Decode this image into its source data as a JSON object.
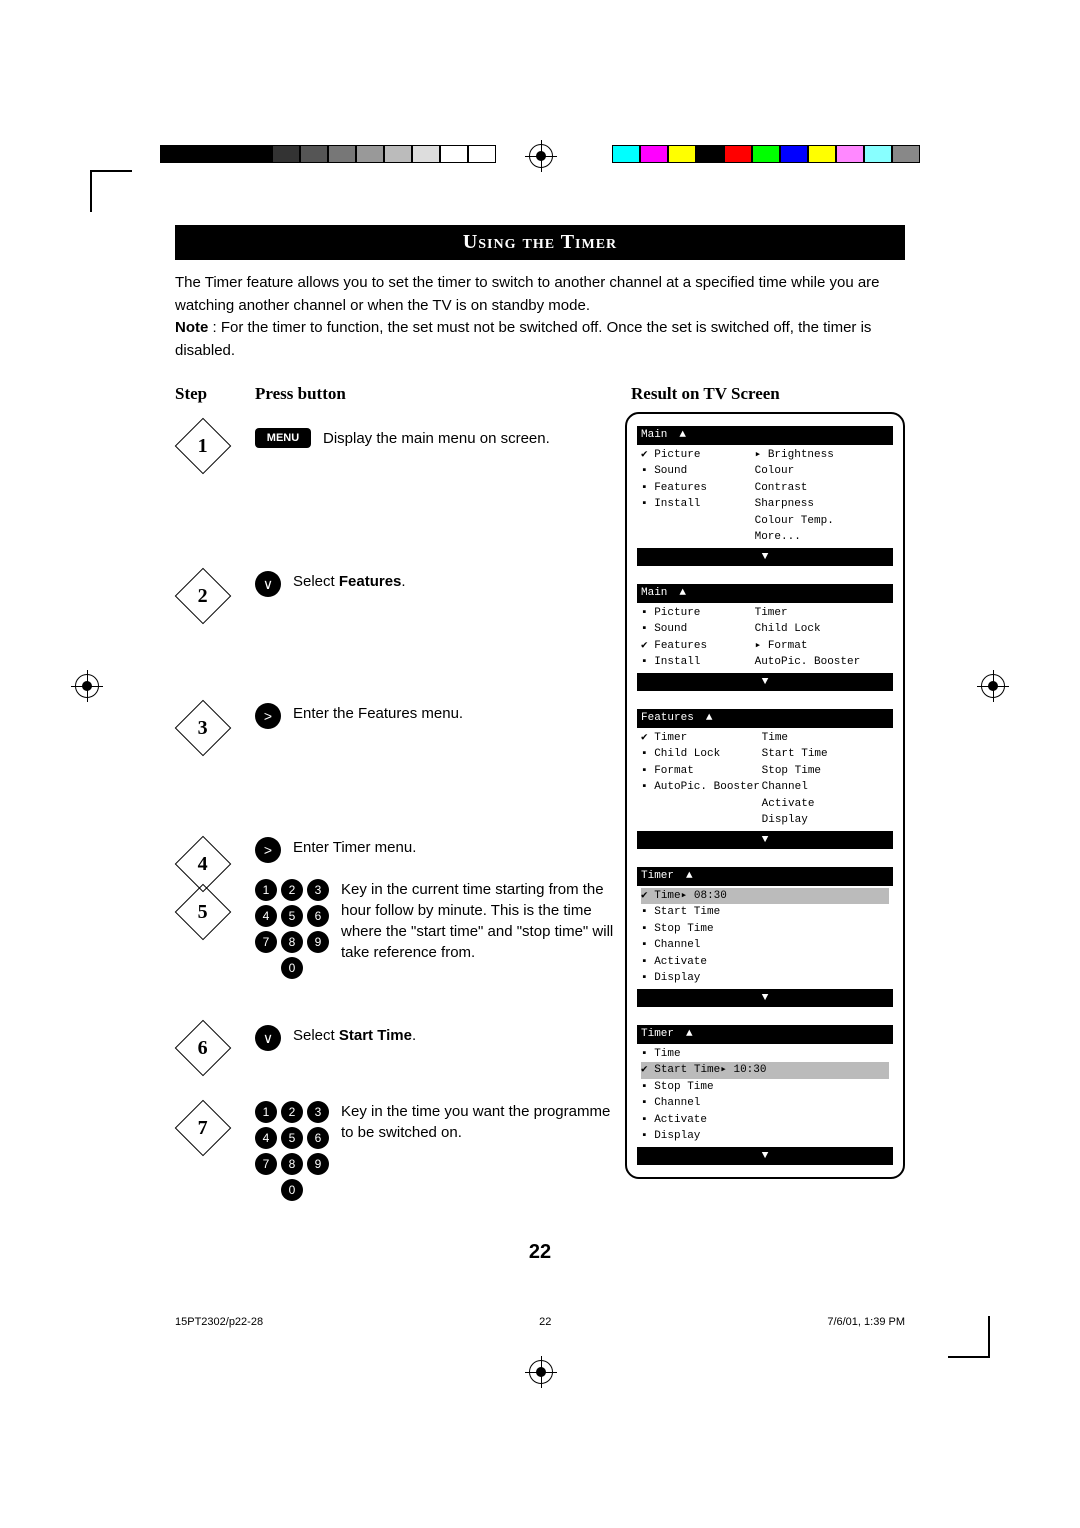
{
  "title": "Using the Timer",
  "intro_part1": "The Timer feature allows you to set the timer to switch to another channel at a specified time while you are watching another channel or when the TV is on standby mode.",
  "intro_note_label": "Note",
  "intro_part2": " : For the timer to function, the set must not be switched off. Once the set is switched off, the timer is disabled.",
  "headers": {
    "step": "Step",
    "press": "Press button",
    "result": "Result on TV Screen"
  },
  "steps": {
    "s1": {
      "num": "1",
      "btn": "MENU",
      "text": "Display the main menu on screen."
    },
    "s2": {
      "num": "2",
      "btn_glyph": "∨",
      "text_pre": "Select ",
      "text_bold": "Features",
      "text_post": "."
    },
    "s3": {
      "num": "3",
      "btn_glyph": ">",
      "text": "Enter the Features menu."
    },
    "s4": {
      "num": "4",
      "btn_glyph": ">",
      "text": "Enter Timer menu."
    },
    "s5": {
      "num": "5",
      "text": "Key in the current time starting from the hour follow by minute.\nThis is the time where the \"start time\" and \"stop time\" will take reference from."
    },
    "s6": {
      "num": "6",
      "btn_glyph": "∨",
      "text_pre": "Select ",
      "text_bold": "Start Time",
      "text_post": "."
    },
    "s7": {
      "num": "7",
      "text": "Key in the time you want the programme to be switched on."
    }
  },
  "digits": [
    "1",
    "2",
    "3",
    "4",
    "5",
    "6",
    "7",
    "8",
    "9",
    "0"
  ],
  "osd1": {
    "header": "Main",
    "left": [
      {
        "mark": "chk",
        "text": "Picture"
      },
      {
        "mark": "bul",
        "text": "Sound"
      },
      {
        "mark": "bul",
        "text": "Features"
      },
      {
        "mark": "bul",
        "text": "Install"
      }
    ],
    "right": [
      {
        "mark": "ptr",
        "text": "Brightness"
      },
      {
        "mark": "",
        "text": "Colour"
      },
      {
        "mark": "",
        "text": "Contrast"
      },
      {
        "mark": "",
        "text": "Sharpness"
      },
      {
        "mark": "",
        "text": "Colour Temp."
      },
      {
        "mark": "",
        "text": "More..."
      }
    ]
  },
  "osd2": {
    "header": "Main",
    "left": [
      {
        "mark": "bul",
        "text": "Picture"
      },
      {
        "mark": "bul",
        "text": "Sound"
      },
      {
        "mark": "chk",
        "text": "Features"
      },
      {
        "mark": "bul",
        "text": "Install"
      }
    ],
    "right": [
      {
        "mark": "",
        "text": "Timer"
      },
      {
        "mark": "",
        "text": "Child Lock"
      },
      {
        "mark": "ptr",
        "text": "Format"
      },
      {
        "mark": "",
        "text": "AutoPic. Booster"
      }
    ]
  },
  "osd3": {
    "header": "Features",
    "left": [
      {
        "mark": "chk",
        "text": "Timer"
      },
      {
        "mark": "bul",
        "text": "Child Lock"
      },
      {
        "mark": "bul",
        "text": "Format"
      },
      {
        "mark": "bul",
        "text": "AutoPic. Booster"
      }
    ],
    "right": [
      {
        "mark": "",
        "text": "Time"
      },
      {
        "mark": "",
        "text": "Start Time"
      },
      {
        "mark": "",
        "text": "Stop Time"
      },
      {
        "mark": "",
        "text": "Channel"
      },
      {
        "mark": "",
        "text": "Activate"
      },
      {
        "mark": "",
        "text": "Display"
      }
    ],
    "left_sel_ptr": true
  },
  "osd4": {
    "header": "Timer",
    "rows": [
      {
        "mark": "chk",
        "text": "Time",
        "val": "08:30",
        "sel": true,
        "ptr": true
      },
      {
        "mark": "bul",
        "text": "Start Time"
      },
      {
        "mark": "bul",
        "text": "Stop Time"
      },
      {
        "mark": "bul",
        "text": "Channel"
      },
      {
        "mark": "bul",
        "text": "Activate"
      },
      {
        "mark": "bul",
        "text": "Display"
      }
    ]
  },
  "osd5": {
    "header": "Timer",
    "rows": [
      {
        "mark": "bul",
        "text": "Time"
      },
      {
        "mark": "chk",
        "text": "Start Time",
        "val": "10:30",
        "sel": true,
        "ptr": true
      },
      {
        "mark": "bul",
        "text": "Stop Time"
      },
      {
        "mark": "bul",
        "text": "Channel"
      },
      {
        "mark": "bul",
        "text": "Activate"
      },
      {
        "mark": "bul",
        "text": "Display"
      }
    ]
  },
  "page_number": "22",
  "footer": {
    "left": "15PT2302/p22-28",
    "center": "22",
    "right": "7/6/01, 1:39 PM"
  },
  "grayscale": [
    "#000",
    "#000",
    "#000",
    "#000",
    "#333",
    "#555",
    "#777",
    "#999",
    "#bbb",
    "#ddd",
    "#fff",
    "#fff"
  ],
  "colorscale": [
    "#0ff",
    "#f0f",
    "#ff0",
    "#000",
    "#f00",
    "#0f0",
    "#00f",
    "#ff0",
    "#f8f",
    "#8ff",
    "#888"
  ]
}
